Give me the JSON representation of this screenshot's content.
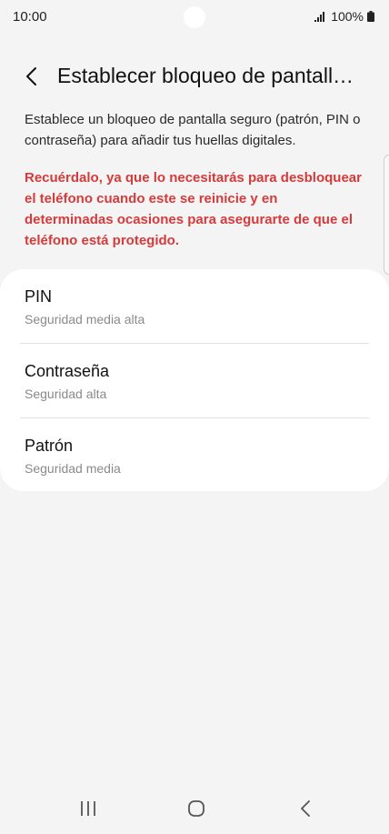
{
  "status_bar": {
    "time": "10:00",
    "battery": "100%"
  },
  "header": {
    "title": "Establecer bloqueo de pantall…"
  },
  "description": "Establece un bloqueo de pantalla seguro (patrón, PIN o contraseña) para añadir tus huellas digitales.",
  "warning": "Recuérdalo, ya que lo necesitarás para desbloquear el teléfono cuando este se reinicie y en determinadas ocasiones para asegurarte de que el teléfono está protegido.",
  "options": [
    {
      "title": "PIN",
      "subtitle": "Seguridad media alta"
    },
    {
      "title": "Contraseña",
      "subtitle": "Seguridad alta"
    },
    {
      "title": "Patrón",
      "subtitle": "Seguridad media"
    }
  ],
  "colors": {
    "background": "#f4f4f4",
    "card": "#ffffff",
    "warning": "#d63a3a",
    "subtitle": "#8a8a8a"
  }
}
